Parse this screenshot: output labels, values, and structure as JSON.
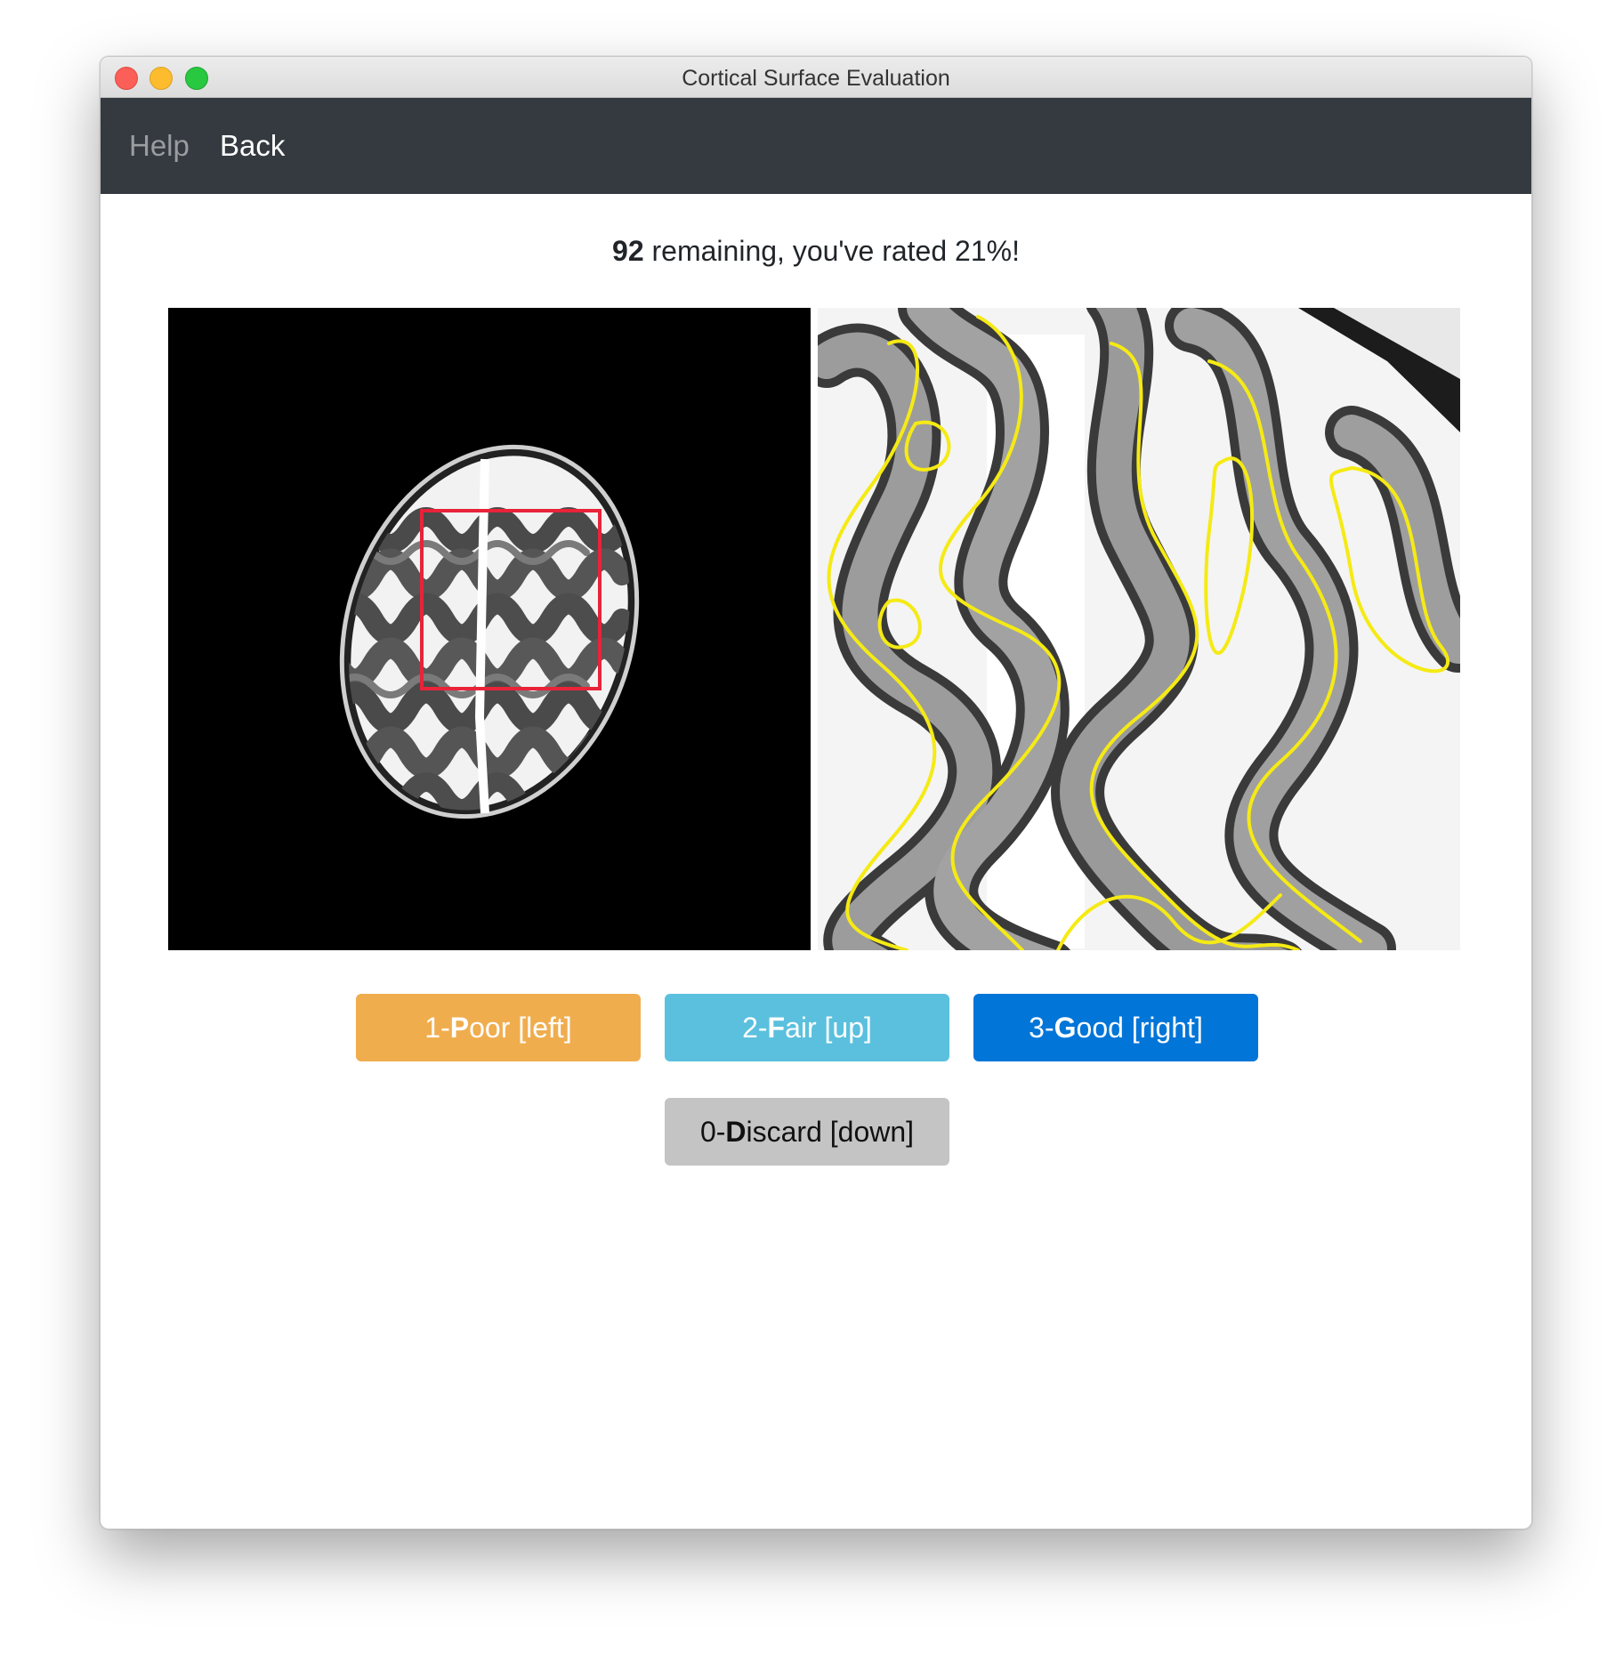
{
  "window": {
    "title": "Cortical Surface Evaluation"
  },
  "navbar": {
    "help_label": "Help",
    "back_label": "Back"
  },
  "status": {
    "remaining": "92",
    "text": " remaining, you've rated 21%!"
  },
  "buttons": {
    "poor": {
      "prefix": "1-",
      "key": "P",
      "rest": "oor [left]"
    },
    "fair": {
      "prefix": "2-",
      "key": "F",
      "rest": "air [up]"
    },
    "good": {
      "prefix": "3-",
      "key": "G",
      "rest": "ood [right]"
    },
    "discard": {
      "prefix": "0-",
      "key": "D",
      "rest": "iscard [down]"
    }
  },
  "colors": {
    "navbar": "#343a40",
    "poor": "#f0ad4e",
    "fair": "#5bc0de",
    "good": "#0275d8",
    "discard": "#c4c4c4",
    "roi_box": "#e8233a",
    "contour": "#f5ea14"
  }
}
